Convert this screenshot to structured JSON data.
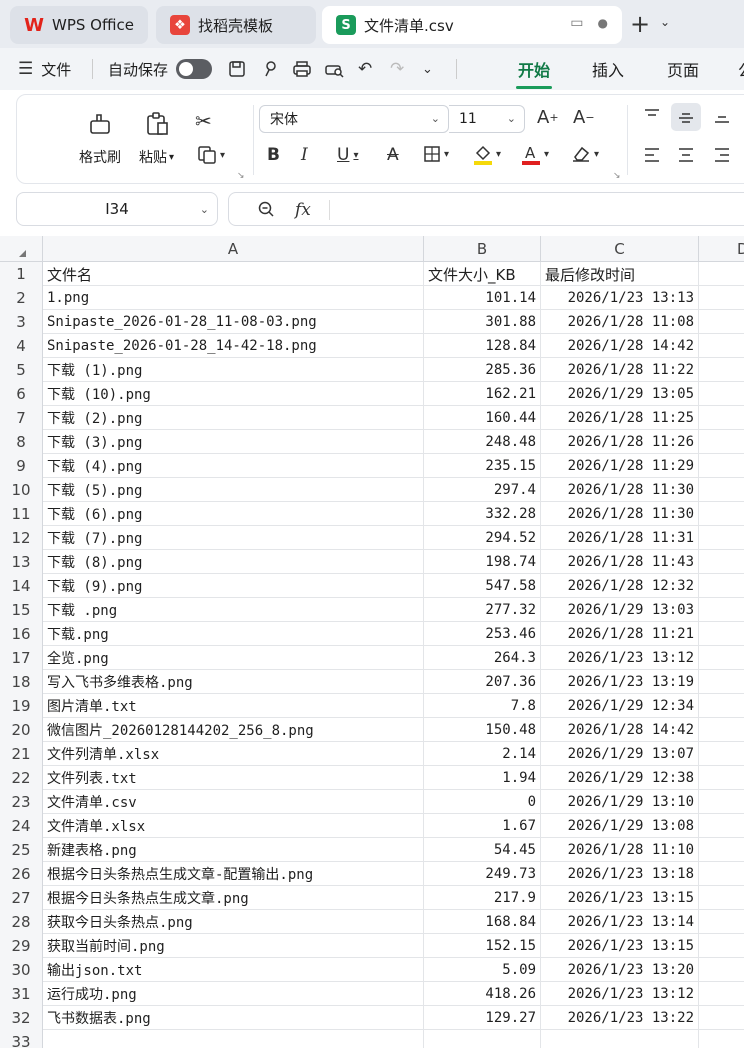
{
  "tabs": [
    {
      "label": "WPS Office",
      "icon": "wps-logo-icon"
    },
    {
      "label": "找稻壳模板",
      "icon": "docer-icon"
    },
    {
      "label": "文件清单.csv",
      "icon": "spreadsheet-s-icon",
      "icon_text": "S"
    }
  ],
  "menubar": {
    "file": "文件",
    "autosave": "自动保存",
    "ribbon_tabs": [
      "开始",
      "插入",
      "页面",
      "公"
    ]
  },
  "ribbon": {
    "format_painter": "格式刷",
    "paste": "粘贴",
    "font_name": "宋体",
    "font_size": "11"
  },
  "formula_bar": {
    "cell_ref": "I34",
    "fx": "fx",
    "value": ""
  },
  "colors": {
    "accent": "#1a9b5b",
    "active_tab_text": "#117a47"
  },
  "sheet": {
    "columns": [
      "A",
      "B",
      "C",
      "D"
    ],
    "row_numbers": [
      "1",
      "2",
      "3",
      "4",
      "5",
      "6",
      "7",
      "8",
      "9",
      "10",
      "11",
      "12",
      "13",
      "14",
      "15",
      "16",
      "17",
      "18",
      "19",
      "20",
      "21",
      "22",
      "23",
      "24",
      "25",
      "26",
      "27",
      "28",
      "29",
      "30",
      "31",
      "32",
      "33"
    ],
    "header": [
      "文件名",
      "文件大小_KB",
      "最后修改时间"
    ],
    "rows": [
      [
        "1.png",
        "101.14",
        "2026/1/23 13:13"
      ],
      [
        "Snipaste_2026-01-28_11-08-03.png",
        "301.88",
        "2026/1/28 11:08"
      ],
      [
        "Snipaste_2026-01-28_14-42-18.png",
        "128.84",
        "2026/1/28 14:42"
      ],
      [
        "下载 (1).png",
        "285.36",
        "2026/1/28 11:22"
      ],
      [
        "下载 (10).png",
        "162.21",
        "2026/1/29 13:05"
      ],
      [
        "下载 (2).png",
        "160.44",
        "2026/1/28 11:25"
      ],
      [
        "下载 (3).png",
        "248.48",
        "2026/1/28 11:26"
      ],
      [
        "下载 (4).png",
        "235.15",
        "2026/1/28 11:29"
      ],
      [
        "下载 (5).png",
        "297.4",
        "2026/1/28 11:30"
      ],
      [
        "下载 (6).png",
        "332.28",
        "2026/1/28 11:30"
      ],
      [
        "下载 (7).png",
        "294.52",
        "2026/1/28 11:31"
      ],
      [
        "下载 (8).png",
        "198.74",
        "2026/1/28 11:43"
      ],
      [
        "下载 (9).png",
        "547.58",
        "2026/1/28 12:32"
      ],
      [
        "下载 .png",
        "277.32",
        "2026/1/29 13:03"
      ],
      [
        "下载.png",
        "253.46",
        "2026/1/28 11:21"
      ],
      [
        "全览.png",
        "264.3",
        "2026/1/23 13:12"
      ],
      [
        "写入飞书多维表格.png",
        "207.36",
        "2026/1/23 13:19"
      ],
      [
        "图片清单.txt",
        "7.8",
        "2026/1/29 12:34"
      ],
      [
        "微信图片_20260128144202_256_8.png",
        "150.48",
        "2026/1/28 14:42"
      ],
      [
        "文件列清单.xlsx",
        "2.14",
        "2026/1/29 13:07"
      ],
      [
        "文件列表.txt",
        "1.94",
        "2026/1/29 12:38"
      ],
      [
        "文件清单.csv",
        "0",
        "2026/1/29 13:10"
      ],
      [
        "文件清单.xlsx",
        "1.67",
        "2026/1/29 13:08"
      ],
      [
        "新建表格.png",
        "54.45",
        "2026/1/28 11:10"
      ],
      [
        "根据今日头条热点生成文章-配置输出.png",
        "249.73",
        "2026/1/23 13:18"
      ],
      [
        "根据今日头条热点生成文章.png",
        "217.9",
        "2026/1/23 13:15"
      ],
      [
        "获取今日头条热点.png",
        "168.84",
        "2026/1/23 13:14"
      ],
      [
        "获取当前时间.png",
        "152.15",
        "2026/1/23 13:15"
      ],
      [
        "输出json.txt",
        "5.09",
        "2026/1/23 13:20"
      ],
      [
        "运行成功.png",
        "418.26",
        "2026/1/23 13:12"
      ],
      [
        "飞书数据表.png",
        "129.27",
        "2026/1/23 13:22"
      ]
    ]
  }
}
